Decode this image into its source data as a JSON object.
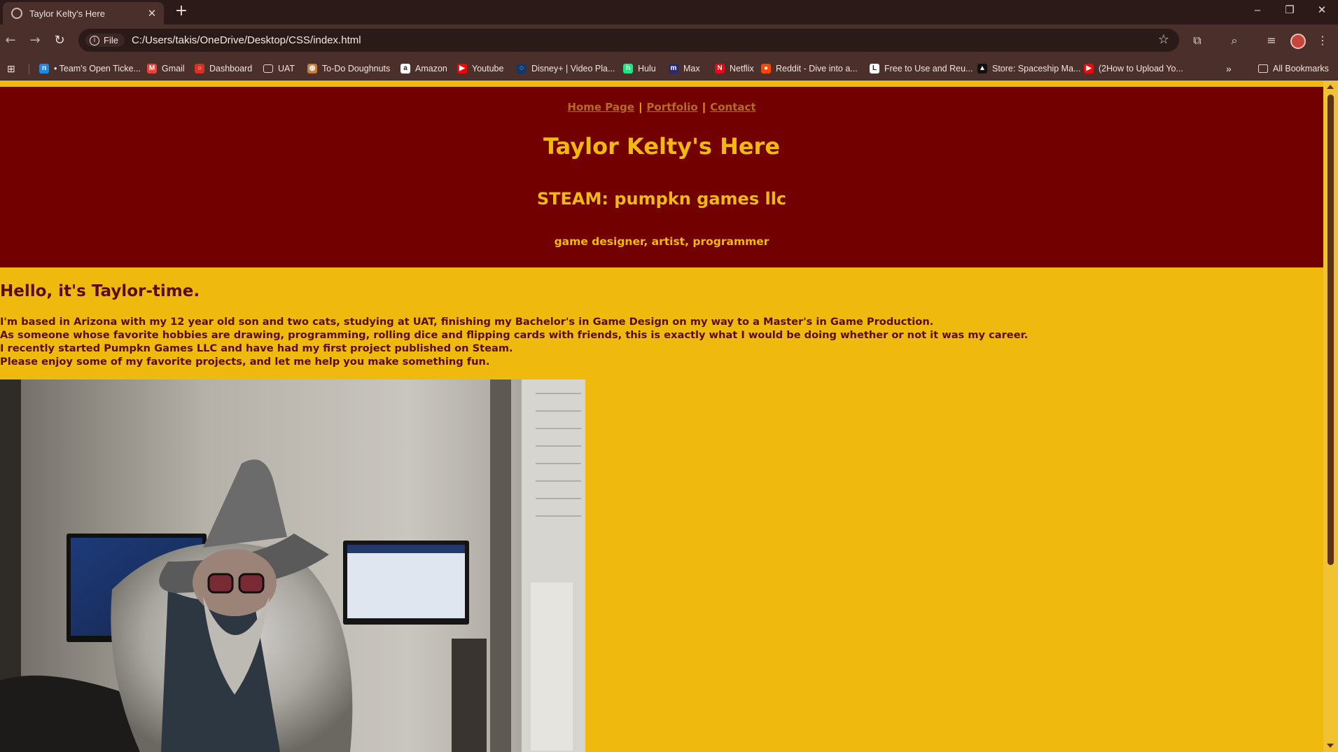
{
  "browser": {
    "tab_title": "Taylor Kelty's Here",
    "new_tab": "+",
    "url_chip": "File",
    "url": "C:/Users/takis/OneDrive/Desktop/CSS/index.html",
    "bookmarks": [
      {
        "label": "• Team's Open Ticke...",
        "icon": "n-app-icon",
        "color": "#1e88e5"
      },
      {
        "label": "Gmail",
        "icon": "gmail-icon",
        "color": "#ea4335"
      },
      {
        "label": "Dashboard",
        "icon": "dashboard-icon",
        "color": "#d93025"
      },
      {
        "label": "UAT",
        "icon": "folder-icon",
        "color": "transparent"
      },
      {
        "label": "To-Do Doughnuts",
        "icon": "doughnut-icon",
        "color": "#c97b3a"
      },
      {
        "label": "Amazon",
        "icon": "amazon-icon",
        "color": "#ffffff"
      },
      {
        "label": "Youtube",
        "icon": "youtube-icon",
        "color": "#ff0000"
      },
      {
        "label": "Disney+ | Video Pla...",
        "icon": "disney-icon",
        "color": "#13386b"
      },
      {
        "label": "Hulu",
        "icon": "hulu-icon",
        "color": "#1ce783"
      },
      {
        "label": "Max",
        "icon": "max-icon",
        "color": "#2a2a6e"
      },
      {
        "label": "Netflix",
        "icon": "netflix-icon",
        "color": "#e50914"
      },
      {
        "label": "Reddit - Dive into a...",
        "icon": "reddit-icon",
        "color": "#ff4500"
      },
      {
        "label": "Free to Use and Reu...",
        "icon": "loc-icon",
        "color": "#ffffff"
      },
      {
        "label": "Store: Spaceship Ma...",
        "icon": "steam-icon",
        "color": "#111111"
      },
      {
        "label": "(2How to Upload Yo...",
        "icon": "youtube-icon",
        "color": "#ff0000"
      }
    ],
    "all_bookmarks": "All Bookmarks"
  },
  "page": {
    "nav": [
      "Home Page",
      "Portfolio",
      "Contact"
    ],
    "nav_separator": "|",
    "title": "Taylor Kelty's Here",
    "subtitle": "STEAM: pumpkn games llc",
    "tagline": "game designer, artist, programmer",
    "greeting": "Hello, it's Taylor-time.",
    "intro_lines": [
      "I'm based in Arizona with my 12 year old son and two cats, studying at UAT, finishing my Bachelor's in Game Design on my way to a Master's in Game Production.",
      "As someone whose favorite hobbies are drawing, programming, rolling dice and flipping cards with friends, this is exactly what I would be doing whether or not it was my career.",
      "I recently started Pumpkn Games LLC and have had my first project published on Steam.",
      "Please enjoy some of my favorite projects, and let me help you make something fun."
    ]
  },
  "colors": {
    "header_bg": "#720000",
    "page_bg": "#efb90d",
    "heading_text": "#efb90d",
    "body_text": "#5a0c0c",
    "link": "#b26d23"
  }
}
